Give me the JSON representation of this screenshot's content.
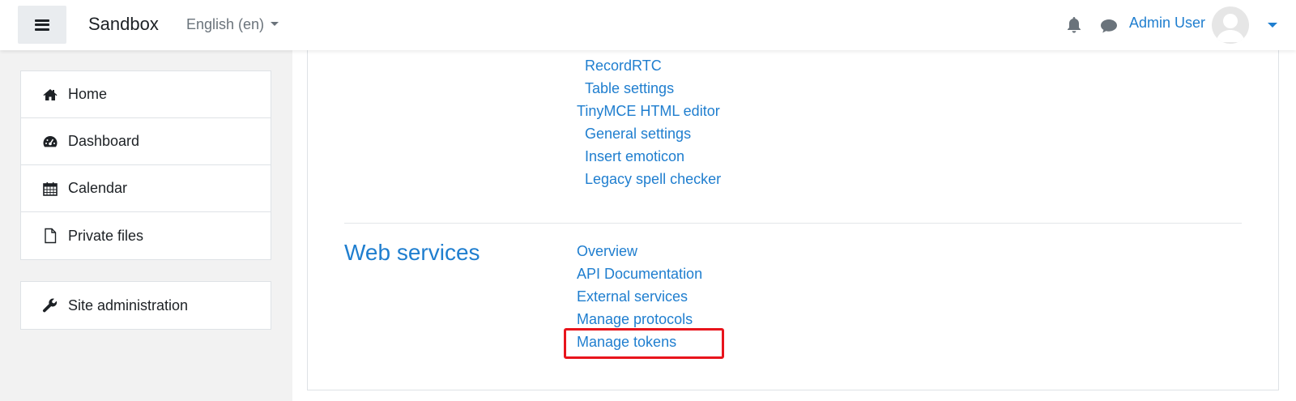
{
  "header": {
    "site_name": "Sandbox",
    "language": "English (en)",
    "user_name": "Admin User"
  },
  "sidebar": {
    "items": [
      {
        "label": "Home",
        "icon": "home-icon"
      },
      {
        "label": "Dashboard",
        "icon": "dashboard-icon"
      },
      {
        "label": "Calendar",
        "icon": "calendar-icon"
      },
      {
        "label": "Private files",
        "icon": "file-icon"
      }
    ],
    "admin": {
      "label": "Site administration",
      "icon": "wrench-icon"
    }
  },
  "main": {
    "editor_links": [
      "RecordRTC",
      "Table settings"
    ],
    "tinymce": {
      "title": "TinyMCE HTML editor",
      "items": [
        "General settings",
        "Insert emoticon",
        "Legacy spell checker"
      ]
    },
    "web_services": {
      "heading": "Web services",
      "items": [
        "Overview",
        "API Documentation",
        "External services",
        "Manage protocols",
        "Manage tokens"
      ]
    }
  },
  "colors": {
    "link": "#1f7ecf",
    "highlight": "#e8141c",
    "drawer_bg": "#f2f2f2"
  }
}
